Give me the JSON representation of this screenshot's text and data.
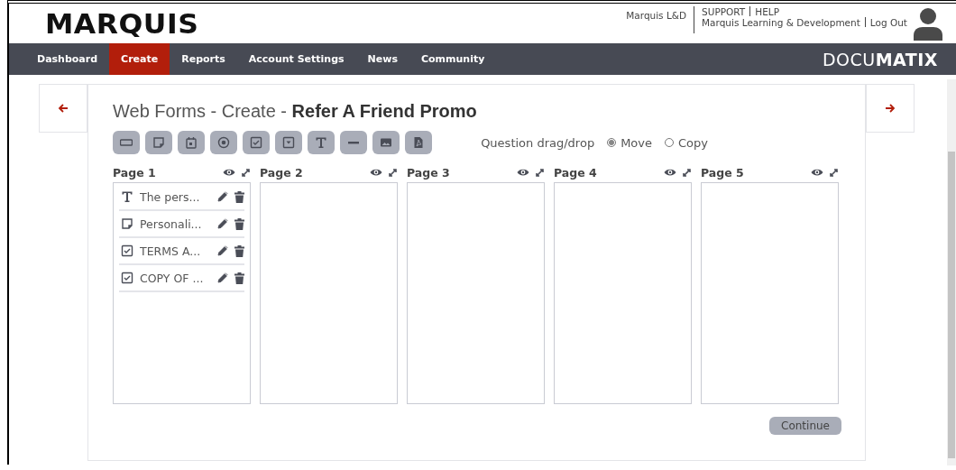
{
  "header": {
    "logo": "MARQUIS",
    "account": "Marquis L&D",
    "support": "SUPPORT",
    "help": "HELP",
    "organization": "Marquis Learning & Development",
    "logout": "Log Out"
  },
  "nav": {
    "items": [
      {
        "label": "Dashboard",
        "selected": false
      },
      {
        "label": "Create",
        "selected": true
      },
      {
        "label": "Reports",
        "selected": false
      },
      {
        "label": "Account Settings",
        "selected": false
      },
      {
        "label": "News",
        "selected": false
      },
      {
        "label": "Community",
        "selected": false
      }
    ],
    "brand": "DOCU**MATIX**"
  },
  "title": "Web Forms - Create - **Refer A Friend Promo**",
  "toolbar": [
    {
      "kind": "textbox"
    },
    {
      "kind": "note"
    },
    {
      "kind": "date"
    },
    {
      "kind": "radio"
    },
    {
      "kind": "checkbox"
    },
    {
      "kind": "dropdown"
    },
    {
      "kind": "text"
    },
    {
      "kind": "line"
    },
    {
      "kind": "image"
    },
    {
      "kind": "pdf"
    }
  ],
  "drag_drop": {
    "label": "Question drag/drop",
    "options": [
      {
        "label": "Move",
        "selected": true
      },
      {
        "label": "Copy",
        "selected": false
      }
    ]
  },
  "pages": [
    {
      "title": "Page 1",
      "items": [
        {
          "kind": "text",
          "label": "The pers..."
        },
        {
          "kind": "note",
          "label": "Personali..."
        },
        {
          "kind": "checkbox",
          "label": "TERMS A..."
        },
        {
          "kind": "checkbox",
          "label": "COPY OF ..."
        }
      ]
    },
    {
      "title": "Page 2"
    },
    {
      "title": "Page 3"
    },
    {
      "title": "Page 4"
    },
    {
      "title": "Page 5"
    }
  ],
  "continue_button": "Continue"
}
